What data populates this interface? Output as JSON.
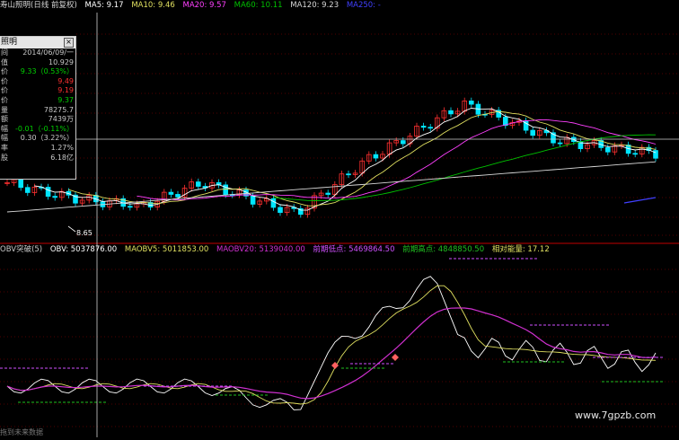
{
  "top_header": {
    "stock_name": "寿山照明(日线 前复权)",
    "ma5": "MA5: 9.17",
    "ma10": "MA10: 9.46",
    "ma20": "MA20: 9.57",
    "ma60": "MA60: 10.11",
    "ma120": "MA120: 9.23",
    "ma250": "MA250: -"
  },
  "info_panel": {
    "title": "照明",
    "close_glyph": "×",
    "rows": [
      {
        "label": "间",
        "value": "2014/06/09/一",
        "color": "#c8c8c8"
      },
      {
        "label": "值",
        "value": "10.929",
        "color": "#c8c8c8"
      },
      {
        "label": "价",
        "value": "9.33（0.53%）",
        "color": "#00d000"
      },
      {
        "label": "价",
        "value": "9.49",
        "color": "#ff3030"
      },
      {
        "label": "价",
        "value": "9.19",
        "color": "#ff3030"
      },
      {
        "label": "价",
        "value": "9.37",
        "color": "#00d000"
      },
      {
        "label": "量",
        "value": "78275.7",
        "color": "#c8c8c8"
      },
      {
        "label": "额",
        "value": "7439万",
        "color": "#c8c8c8"
      },
      {
        "label": "幅",
        "value": "-0.01（-0.11%）",
        "color": "#00d000"
      },
      {
        "label": "幅",
        "value": "0.30（3.22%）",
        "color": "#c8c8c8"
      },
      {
        "label": "率",
        "value": "1.27%",
        "color": "#c8c8c8"
      },
      {
        "label": "股",
        "value": "6.18亿",
        "color": "#c8c8c8"
      }
    ]
  },
  "price_labels": {
    "low_label": "8.65"
  },
  "obv_header": {
    "name": "OBV突破(5)",
    "obv": "OBV: 5037876.00",
    "maobv5": "MAOBV5: 5011853.00",
    "maobv20": "MAOBV20: 5139040.00",
    "prev_low": "前期低点: 5469864.50",
    "prev_high": "前期高点: 4848850.50",
    "relative": "相对能量: 17.12"
  },
  "watermark": "www.7gpzb.com",
  "footer_text": "拖到未来数据",
  "colors": {
    "up": "#ff3030",
    "down": "#00e5ff",
    "ma5": "#ffffff",
    "ma10": "#e0e060",
    "ma20": "#ff40ff",
    "ma60": "#00c000",
    "ma120": "#d8d8d8",
    "ma250": "#4040ff",
    "obv": "#ffffff",
    "maobv5": "#e0e060",
    "maobv20": "#d030d0",
    "prev_low_line": "#d050ff",
    "prev_high_line": "#20c020",
    "grid": "#a00000",
    "cursor": "#d0d0d0"
  }
}
